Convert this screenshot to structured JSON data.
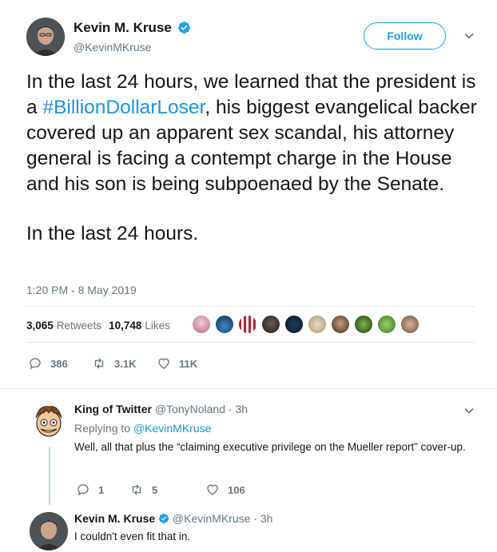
{
  "tweet": {
    "author_name": "Kevin M. Kruse",
    "author_handle": "@KevinMKruse",
    "follow_label": "Follow",
    "text_part1": "In the last 24 hours, we learned that the president is a ",
    "hashtag": "#BillionDollarLoser",
    "text_part2": ", his biggest evangelical backer covered up an apparent sex scandal, his attorney general is facing a contempt charge in the House and his son is being subpoenaed by the Senate.",
    "text_para2": "In the last 24 hours.",
    "timestamp": "1:20 PM - 8 May 2019",
    "retweets_count": "3,065",
    "retweets_label": "Retweets",
    "likes_count": "10,748",
    "likes_label": "Likes",
    "reply_count": "386",
    "retweet_count_short": "3.1K",
    "like_count_short": "11K"
  },
  "replies": [
    {
      "name": "King of Twitter",
      "handle": "@TonyNoland",
      "time": "3h",
      "replying_to_label": "Replying to",
      "replying_to_handle": "@KevinMKruse",
      "text": "Well, all that plus the “claiming executive privilege on the Mueller report” cover-up.",
      "reply_count": "1",
      "retweet_count": "5",
      "like_count": "106"
    },
    {
      "name": "Kevin M. Kruse",
      "handle": "@KevinMKruse",
      "time": "3h",
      "text": "I couldn't even fit that in."
    }
  ],
  "colors": {
    "accent": "#1da1f2",
    "link": "#1b95e0",
    "muted": "#657786",
    "text": "#14171a"
  }
}
